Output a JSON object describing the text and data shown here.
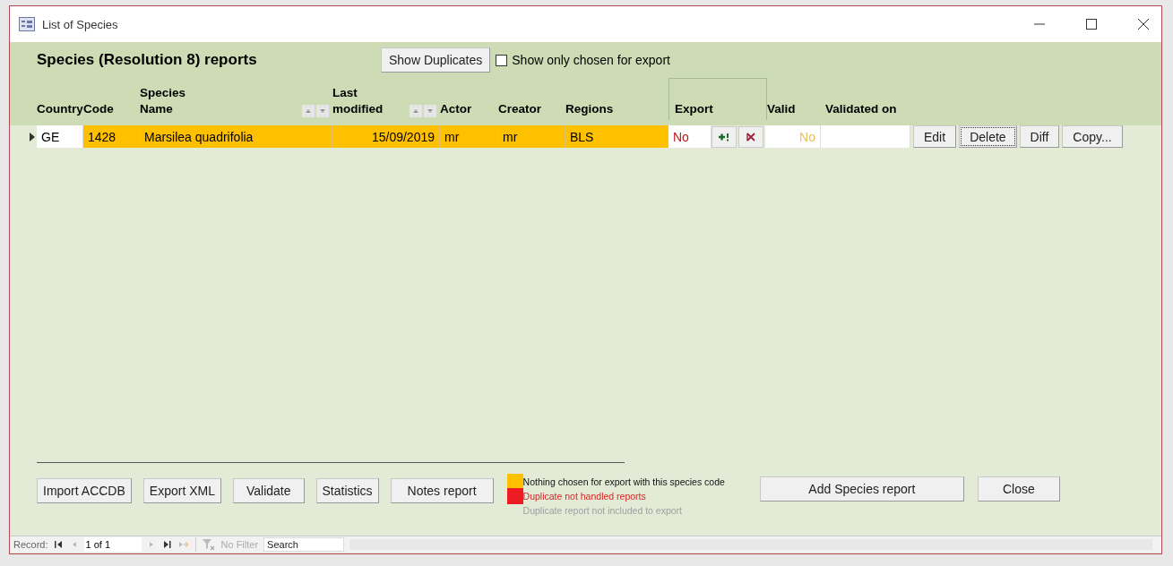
{
  "window": {
    "title": "List of Species"
  },
  "header": {
    "title": "Species (Resolution 8) reports",
    "show_duplicates_button": "Show Duplicates",
    "export_filter": {
      "label": "Show only chosen for export",
      "checked": false
    }
  },
  "table": {
    "columns": [
      {
        "kind": "plain",
        "lines": [
          "Country"
        ]
      },
      {
        "kind": "plain",
        "lines": [
          "Code"
        ]
      },
      {
        "kind": "sort",
        "lines": [
          "Species",
          "Name"
        ]
      },
      {
        "kind": "sort",
        "lines": [
          "Last",
          "modified"
        ]
      },
      {
        "kind": "plain",
        "lines": [
          "Actor"
        ]
      },
      {
        "kind": "plain",
        "lines": [
          "Creator"
        ]
      },
      {
        "kind": "plain",
        "lines": [
          "Regions"
        ]
      },
      {
        "kind": "framed",
        "lines": [
          "Export"
        ]
      },
      {
        "kind": "plain",
        "lines": [
          "Valid"
        ]
      },
      {
        "kind": "plain",
        "lines": [
          "Validated on"
        ]
      }
    ],
    "rows": [
      {
        "current": true,
        "color": "#ffc000",
        "country": "GE",
        "code": "1428",
        "name": "Marsilea quadrifolia",
        "modified": "15/09/2019",
        "actor": "mr",
        "creator": "mr",
        "regions": "BLS",
        "export": "No",
        "valid": "No",
        "buttons": [
          {
            "label": "Edit",
            "focused": false
          },
          {
            "label": "Delete",
            "focused": true
          },
          {
            "label": "Diff",
            "focused": false
          },
          {
            "label": "Copy...",
            "focused": false
          }
        ]
      }
    ]
  },
  "actions": [
    "Import ACCDB",
    "Export XML",
    "Validate",
    "Statistics",
    "Notes report"
  ],
  "legend": [
    {
      "kind": "normal",
      "color": "#ffc000",
      "text": "Nothing chosen for export with this species  code"
    },
    {
      "kind": "alert",
      "color": "#ed1c24",
      "text": "Duplicate not handled reports"
    },
    {
      "kind": "muted",
      "text": "Duplicate report not included to export"
    }
  ],
  "right_actions": [
    "Add Species report",
    "Close"
  ],
  "navigation": {
    "label": "Record:",
    "position": "1 of 1",
    "filter": "No Filter",
    "search": {
      "placeholder": "Search"
    }
  }
}
